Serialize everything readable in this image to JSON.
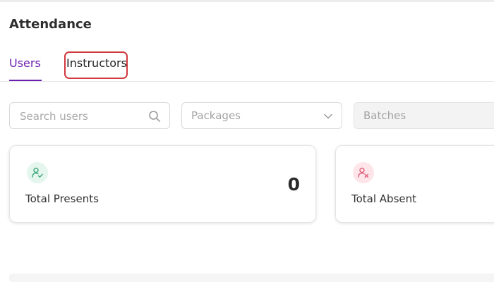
{
  "page": {
    "title": "Attendance"
  },
  "tabs": [
    {
      "label": "Users",
      "active": true
    },
    {
      "label": "Instructors",
      "active": false
    }
  ],
  "filters": {
    "search_placeholder": "Search users",
    "search_value": "",
    "packages_placeholder": "Packages",
    "batches_placeholder": "Batches"
  },
  "cards": [
    {
      "label": "Total Presents",
      "value": "0",
      "icon": "user-check-icon",
      "color": "#3fa77a"
    },
    {
      "label": "Total Absent",
      "value": "",
      "icon": "user-x-icon",
      "color": "#e0607a"
    }
  ],
  "colors": {
    "accent": "#6b1fb0",
    "highlight": "#d0393f"
  }
}
